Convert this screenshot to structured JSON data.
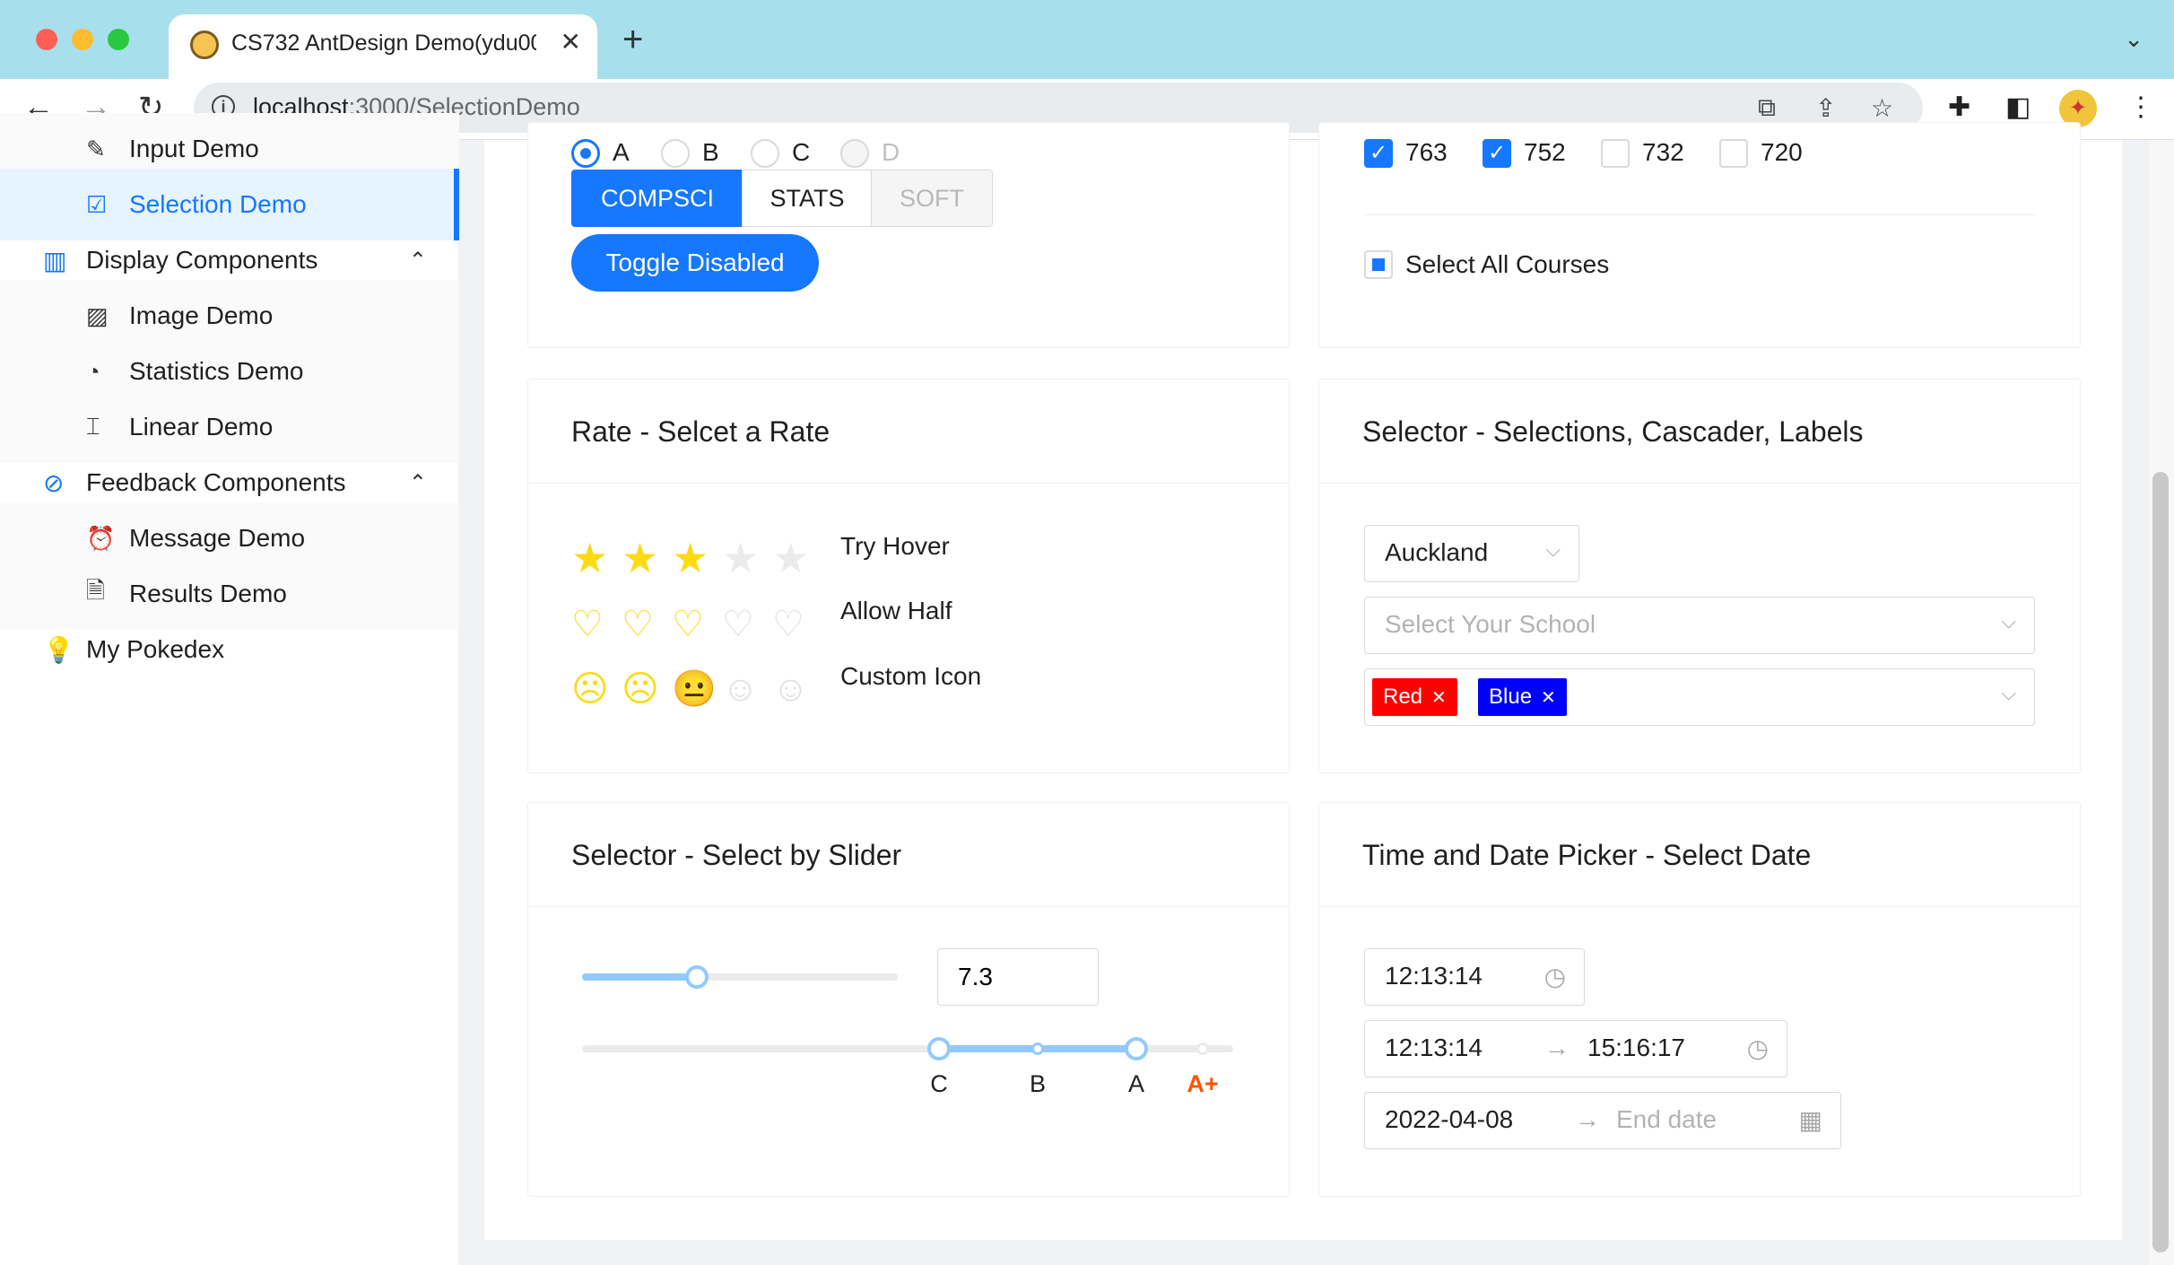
{
  "browser": {
    "tab_title": "CS732 AntDesign Demo(ydu00",
    "tab_close": "✕",
    "new_tab": "+",
    "url_host": "localhost",
    "url_rest": ":3000/SelectionDemo",
    "tabbar_chevron": "⌄",
    "colors": {
      "tabbar": "#a7e0ec",
      "close": "#ff5f57",
      "minimize": "#febc2e",
      "zoom": "#28c840"
    }
  },
  "sidebar": {
    "items": [
      {
        "label": "Input Demo",
        "icon": "edit-icon",
        "glyph": "✎",
        "type": "sub"
      },
      {
        "label": "Selection Demo",
        "icon": "check-square-icon",
        "glyph": "☑",
        "type": "sub",
        "selected": true
      },
      {
        "label": "Display Components",
        "icon": "project-icon",
        "glyph": "▥",
        "type": "group",
        "caret": "⌃"
      },
      {
        "label": "Image Demo",
        "icon": "picture-icon",
        "glyph": "▨",
        "type": "sub"
      },
      {
        "label": "Statistics Demo",
        "icon": "pie-chart-icon",
        "glyph": "◔",
        "type": "sub"
      },
      {
        "label": "Linear Demo",
        "icon": "column-height-icon",
        "glyph": "⌶",
        "type": "sub"
      },
      {
        "label": "Feedback Components",
        "icon": "compass-icon",
        "glyph": "⊘",
        "type": "group",
        "caret": "⌃"
      },
      {
        "label": "Message Demo",
        "icon": "alert-icon",
        "glyph": "⏰",
        "type": "sub"
      },
      {
        "label": "Results Demo",
        "icon": "file-icon",
        "glyph": "🗎",
        "type": "sub"
      },
      {
        "label": "My Pokedex",
        "icon": "bulb-icon",
        "glyph": "💡",
        "type": "group"
      }
    ]
  },
  "radio_card": {
    "radios": [
      {
        "label": "A",
        "checked": true,
        "disabled": false
      },
      {
        "label": "B",
        "checked": false,
        "disabled": false
      },
      {
        "label": "C",
        "checked": false,
        "disabled": false
      },
      {
        "label": "D",
        "checked": false,
        "disabled": true
      }
    ],
    "buttons": [
      {
        "label": "COMPSCI",
        "state": "active"
      },
      {
        "label": "STATS",
        "state": "normal"
      },
      {
        "label": "SOFT",
        "state": "disabled"
      }
    ],
    "toggle_label": "Toggle Disabled"
  },
  "checkbox_card": {
    "courses": [
      {
        "label": "763",
        "checked": true
      },
      {
        "label": "752",
        "checked": true
      },
      {
        "label": "732",
        "checked": false
      },
      {
        "label": "720",
        "checked": false
      }
    ],
    "select_all_label": "Select All Courses",
    "select_all_state": "indeterminate"
  },
  "rate_card": {
    "title": "Rate - Selcet a Rate",
    "rows": [
      {
        "label": "Try Hover",
        "kind": "star",
        "value": 3,
        "glyphs": [
          "★",
          "★",
          "★",
          "★",
          "★"
        ]
      },
      {
        "label": "Allow Half",
        "kind": "heart",
        "value": 2.5,
        "glyphs": [
          "♡",
          "♡",
          "♡",
          "♡",
          "♡"
        ]
      },
      {
        "label": "Custom Icon",
        "kind": "face",
        "value": 3,
        "glyphs": [
          "☹",
          "☹",
          "😐",
          "☺",
          "☺"
        ]
      }
    ],
    "colors": {
      "active": "#fadb14",
      "inactive": "#f0f0f0"
    }
  },
  "selector_card": {
    "title": "Selector - Selections, Cascader, Labels",
    "city_value": "Auckland",
    "school_placeholder": "Select Your School",
    "tags": [
      {
        "label": "Red",
        "color": "#ff0000"
      },
      {
        "label": "Blue",
        "color": "#0000ff"
      }
    ],
    "arrow": "⌵",
    "tag_close": "✕"
  },
  "slider_card": {
    "title": "Selector - Select by Slider",
    "slider_value": 7.3,
    "slider_min": 0,
    "slider_max": 20,
    "input_value": "7.3",
    "range_marks": [
      "C",
      "B",
      "A",
      "A+"
    ],
    "range_from": "C",
    "range_to": "A"
  },
  "date_card": {
    "title": "Time and Date Picker - Select Date",
    "time_value": "12:13:14",
    "range_start": "12:13:14",
    "range_end": "15:16:17",
    "date_start": "2022-04-08",
    "date_end_placeholder": "End date",
    "arrow": "→",
    "clock_icon": "◷",
    "calendar_icon": "▦"
  },
  "accent": "#1677ff"
}
